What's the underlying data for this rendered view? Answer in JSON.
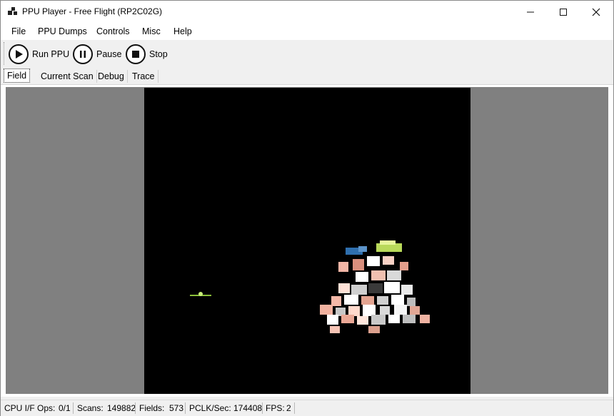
{
  "window": {
    "title": "PPU Player - Free Flight (RP2C02G)",
    "icons": {
      "app": "app-window-icon",
      "minimize": "minimize-icon",
      "maximize": "maximize-icon",
      "close": "close-icon"
    }
  },
  "menu": {
    "items": [
      {
        "label": "File"
      },
      {
        "label": "PPU Dumps"
      },
      {
        "label": "Controls"
      },
      {
        "label": "Misc"
      },
      {
        "label": "Help"
      }
    ]
  },
  "toolbar": {
    "run_label": "Run PPU",
    "pause_label": "Pause",
    "stop_label": "Stop",
    "icons": {
      "run": "play-icon",
      "pause": "pause-icon",
      "stop": "stop-icon"
    }
  },
  "tabs": [
    {
      "label": "Field",
      "active": true
    },
    {
      "label": "Current Scan",
      "active": false
    },
    {
      "label": "Debug",
      "active": false
    },
    {
      "label": "Trace",
      "active": false
    }
  ],
  "status": {
    "cpu_label": "CPU I/F Ops:",
    "cpu_value": "0/1",
    "scans_label": "Scans:",
    "scans_value": "149882",
    "fields_label": "Fields:",
    "fields_value": "573",
    "pclk_label": "PCLK/Sec:",
    "pclk_value": "174408",
    "fps_label": "FPS:",
    "fps_value": "2"
  },
  "colors": {
    "field_background": "#808080",
    "screen_background": "#000000"
  }
}
